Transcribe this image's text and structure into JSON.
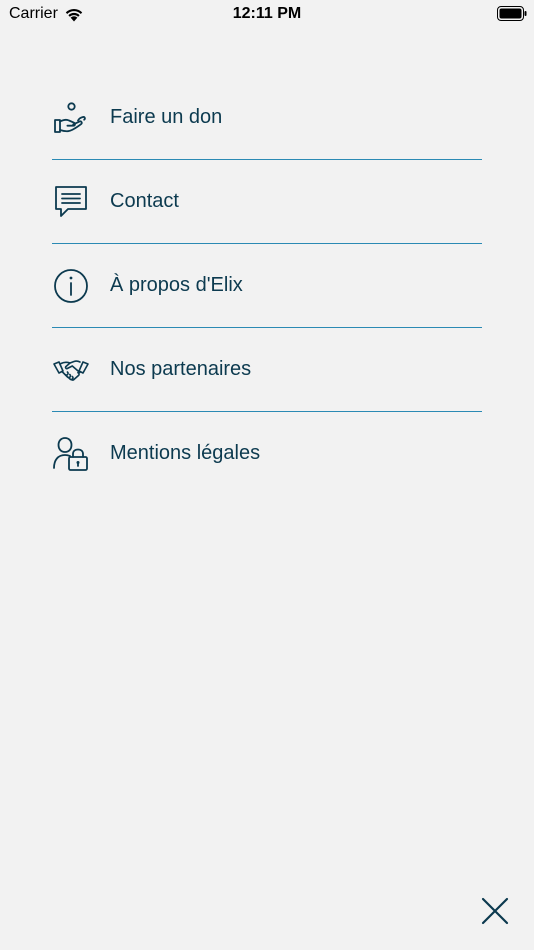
{
  "status_bar": {
    "carrier": "Carrier",
    "time": "12:11 PM"
  },
  "menu": {
    "items": [
      {
        "label": "Faire un don",
        "icon": "donate-hand-icon"
      },
      {
        "label": "Contact",
        "icon": "chat-bubble-icon"
      },
      {
        "label": "À propos d'Elix",
        "icon": "info-icon"
      },
      {
        "label": "Nos partenaires",
        "icon": "handshake-icon"
      },
      {
        "label": "Mentions légales",
        "icon": "user-lock-icon"
      }
    ]
  },
  "colors": {
    "background": "#f2f2f2",
    "text": "#0c3a4f",
    "divider": "#2b8ab4"
  },
  "close": {
    "icon": "close-icon"
  }
}
